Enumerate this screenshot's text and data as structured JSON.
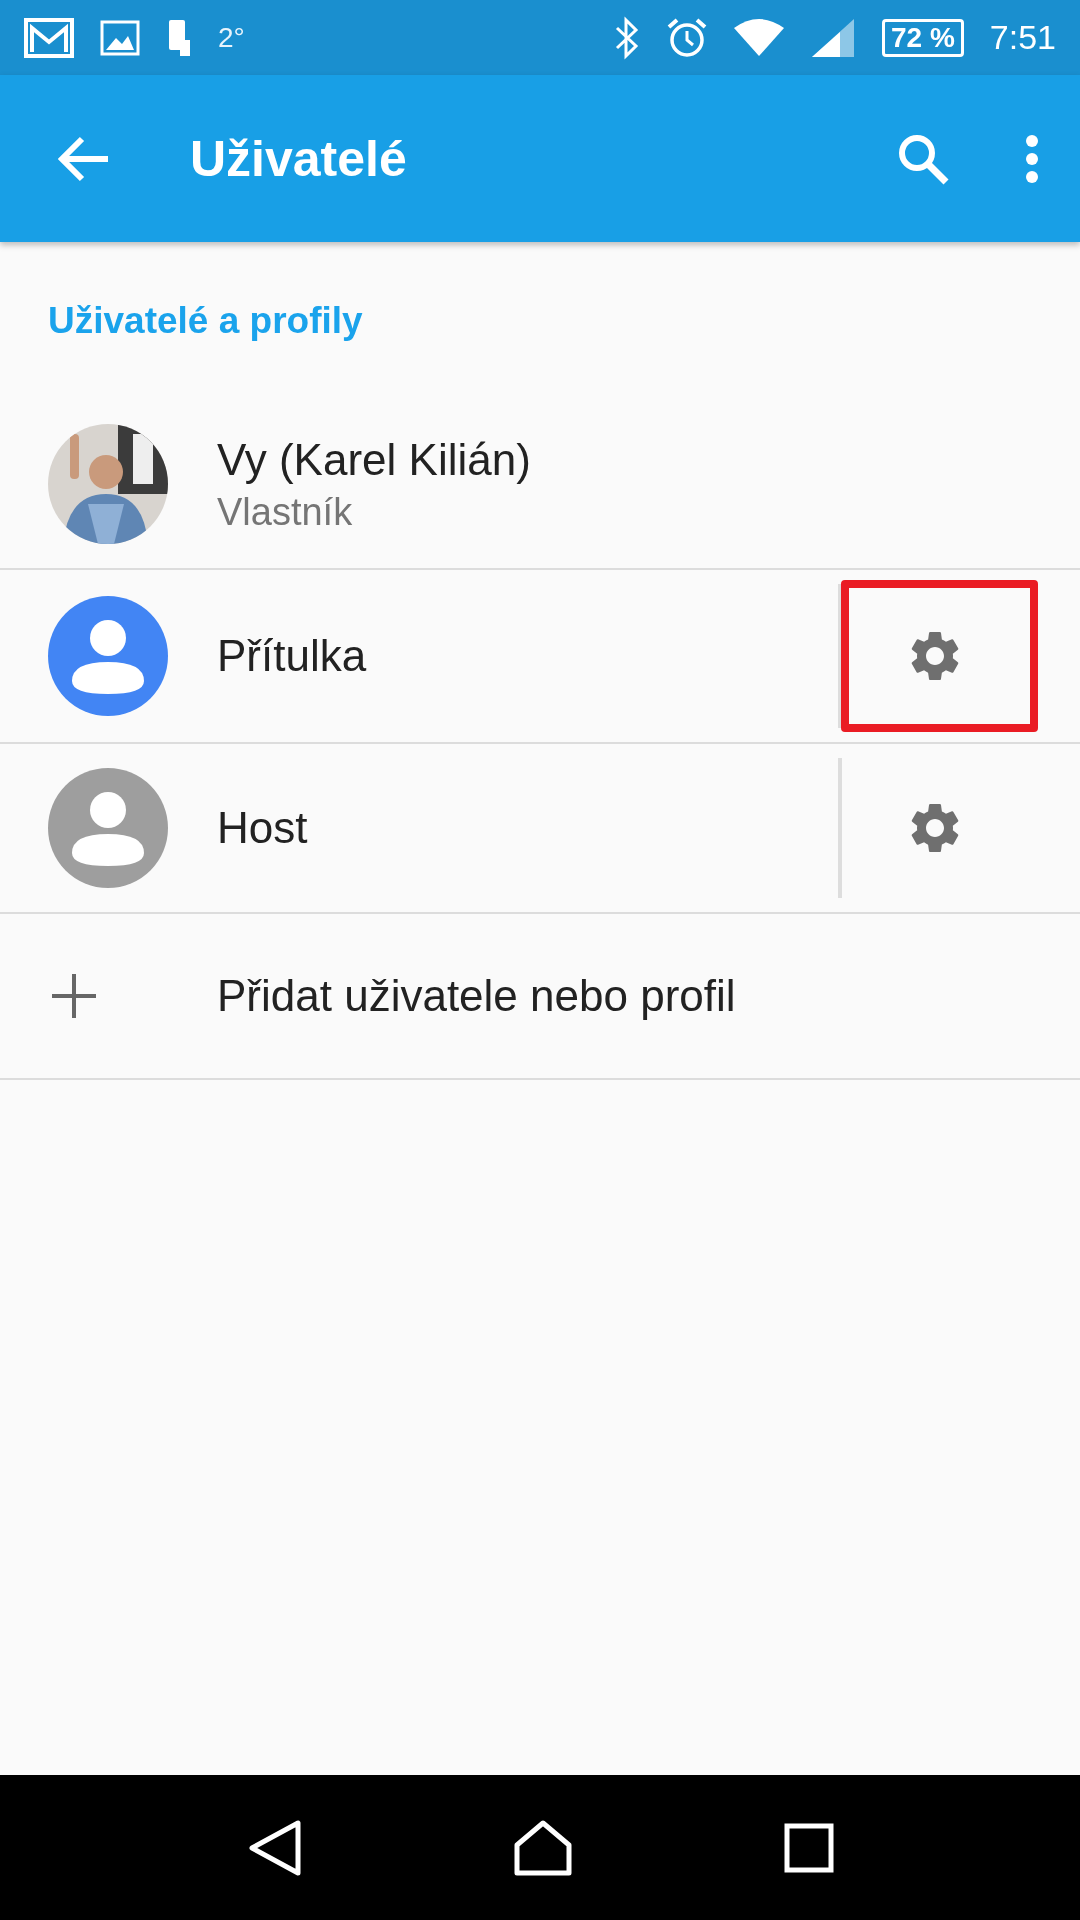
{
  "status_bar": {
    "temperature": "2°",
    "battery": "72 %",
    "time": "7:51"
  },
  "app_bar": {
    "title": "Uživatelé"
  },
  "section": {
    "title": "Uživatelé a profily"
  },
  "users": [
    {
      "name": "Vy (Karel Kilián)",
      "subtitle": "Vlastník",
      "settings": false,
      "highlighted": false
    },
    {
      "kind": "blue",
      "name": "Přítulka",
      "settings": true,
      "highlighted": true
    },
    {
      "kind": "grey",
      "name": "Host",
      "settings": true,
      "highlighted": false
    }
  ],
  "add_action": {
    "label": "Přidat uživatele nebo profil"
  }
}
